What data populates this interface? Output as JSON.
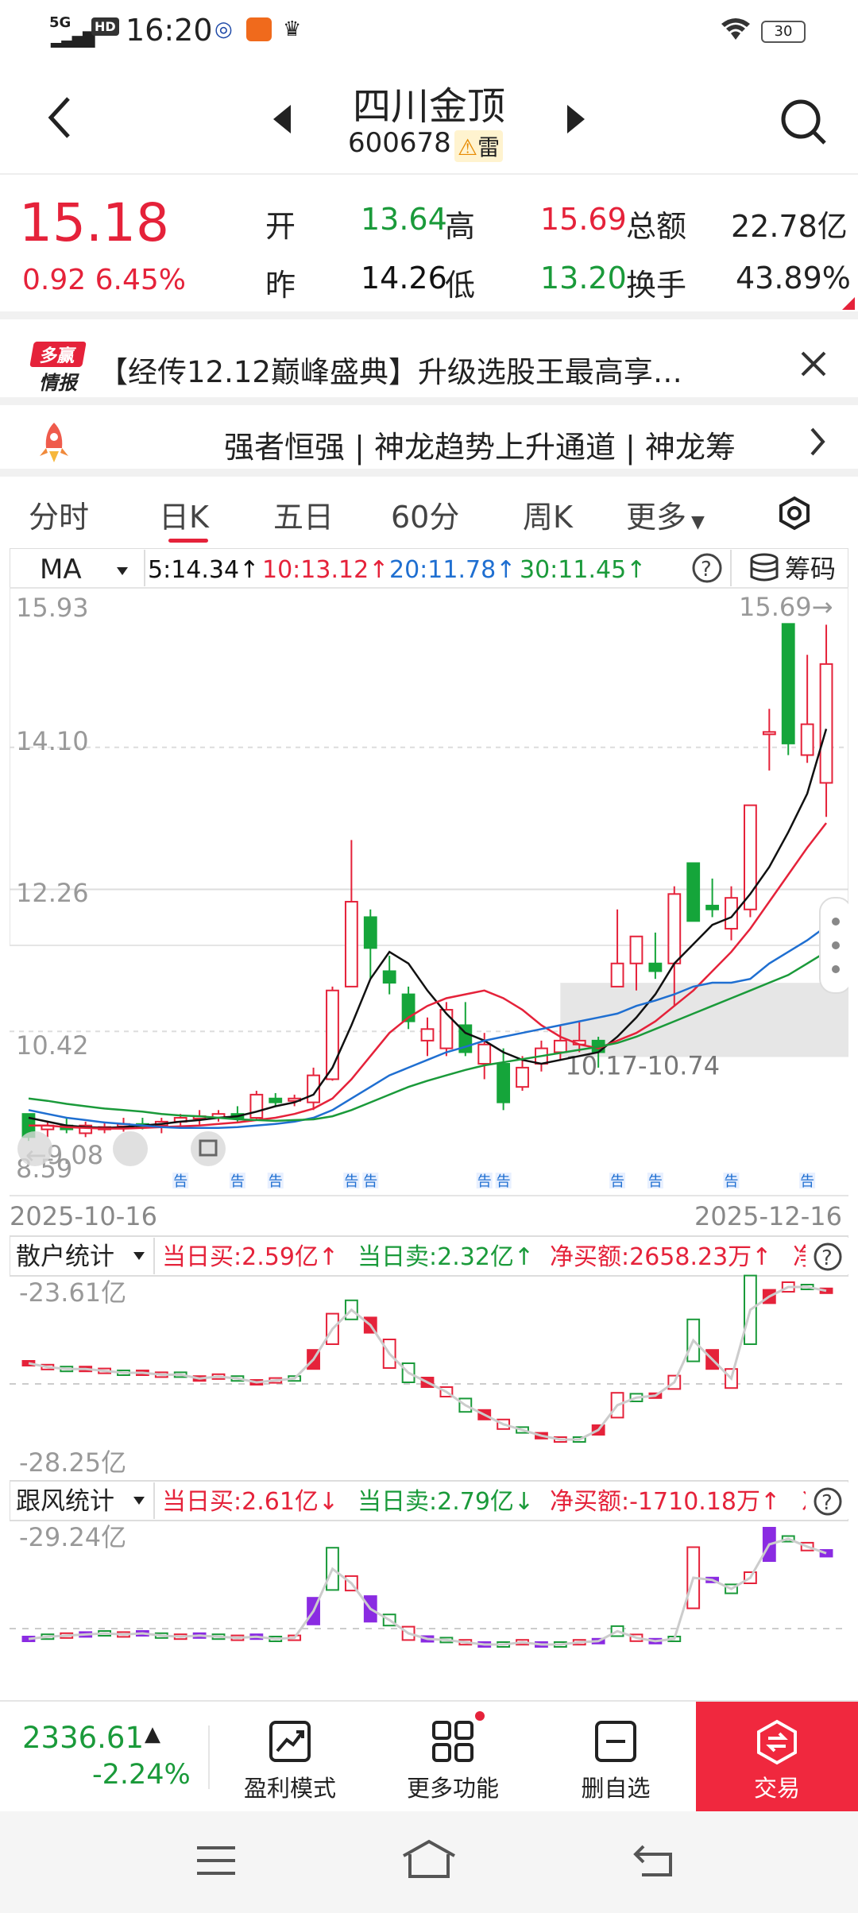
{
  "status": {
    "network": "5G",
    "hd": "HD",
    "time": "16:20",
    "battery": "30"
  },
  "nav": {
    "stock_name": "四川金顶",
    "stock_code": "600678",
    "risk_tag": "雷"
  },
  "quote": {
    "price": "15.18",
    "change": "0.92",
    "change_pct": "6.45%",
    "open_label": "开",
    "open": "13.64",
    "high_label": "高",
    "high": "15.69",
    "amount_label": "总额",
    "amount": "22.78亿",
    "prev_label": "昨",
    "prev": "14.26",
    "low_label": "低",
    "low": "13.20",
    "turnover_label": "换手",
    "turnover": "43.89%"
  },
  "ad": {
    "logo_line1": "多赢",
    "logo_line2": "情报",
    "text": "【经传12.12巅峰盛典】升级选股王最高享…"
  },
  "banner": {
    "text": "强者恒强 | 神龙趋势上升通道 | 神龙筹"
  },
  "tabs": [
    "分时",
    "日K",
    "五日",
    "60分",
    "周K",
    "更多"
  ],
  "active_tab": "日K",
  "ma_bar": {
    "indicator": "MA",
    "ma5": "5:14.34↑",
    "ma10": "10:13.12↑",
    "ma20": "20:11.78↑",
    "ma30": "30:11.45↑",
    "chips_label": "筹码"
  },
  "main_chart": {
    "y_labels": [
      "15.93",
      "14.10",
      "12.26",
      "10.42",
      "8.59"
    ],
    "high_marker": "15.69→",
    "low_marker": "←9.08",
    "support_zone": "10.17-10.74",
    "date_start": "2025-10-16",
    "date_end": "2025-12-16",
    "notice_label": "告"
  },
  "chart_data": {
    "type": "candlestick",
    "x_range": [
      "2025-10-16",
      "2025-12-16"
    ],
    "y_range": [
      8.59,
      15.93
    ],
    "candles": [
      {
        "o": 9.35,
        "h": 9.35,
        "l": 9.0,
        "c": 9.05
      },
      {
        "o": 9.15,
        "h": 9.25,
        "l": 9.05,
        "c": 9.2
      },
      {
        "o": 9.2,
        "h": 9.3,
        "l": 9.1,
        "c": 9.15
      },
      {
        "o": 9.1,
        "h": 9.25,
        "l": 9.05,
        "c": 9.2
      },
      {
        "o": 9.15,
        "h": 9.25,
        "l": 9.1,
        "c": 9.18
      },
      {
        "o": 9.2,
        "h": 9.3,
        "l": 9.12,
        "c": 9.22
      },
      {
        "o": 9.22,
        "h": 9.3,
        "l": 9.15,
        "c": 9.18
      },
      {
        "o": 9.2,
        "h": 9.3,
        "l": 9.1,
        "c": 9.25
      },
      {
        "o": 9.25,
        "h": 9.35,
        "l": 9.2,
        "c": 9.3
      },
      {
        "o": 9.3,
        "h": 9.4,
        "l": 9.2,
        "c": 9.32
      },
      {
        "o": 9.3,
        "h": 9.4,
        "l": 9.25,
        "c": 9.35
      },
      {
        "o": 9.35,
        "h": 9.45,
        "l": 9.25,
        "c": 9.3
      },
      {
        "o": 9.3,
        "h": 9.65,
        "l": 9.28,
        "c": 9.6
      },
      {
        "o": 9.55,
        "h": 9.62,
        "l": 9.45,
        "c": 9.5
      },
      {
        "o": 9.52,
        "h": 9.6,
        "l": 9.45,
        "c": 9.55
      },
      {
        "o": 9.5,
        "h": 9.95,
        "l": 9.4,
        "c": 9.85
      },
      {
        "o": 9.8,
        "h": 11.0,
        "l": 9.78,
        "c": 10.95
      },
      {
        "o": 11.0,
        "h": 12.9,
        "l": 11.9,
        "c": 12.1
      },
      {
        "o": 11.9,
        "h": 12.0,
        "l": 11.1,
        "c": 11.5
      },
      {
        "o": 11.2,
        "h": 11.4,
        "l": 10.9,
        "c": 11.05
      },
      {
        "o": 10.9,
        "h": 11.0,
        "l": 10.45,
        "c": 10.55
      },
      {
        "o": 10.3,
        "h": 10.6,
        "l": 10.1,
        "c": 10.45
      },
      {
        "o": 10.2,
        "h": 10.8,
        "l": 10.1,
        "c": 10.7
      },
      {
        "o": 10.5,
        "h": 10.8,
        "l": 10.1,
        "c": 10.15
      },
      {
        "o": 10.0,
        "h": 10.4,
        "l": 9.8,
        "c": 10.25
      },
      {
        "o": 10.0,
        "h": 10.2,
        "l": 9.4,
        "c": 9.5
      },
      {
        "o": 9.7,
        "h": 10.1,
        "l": 9.65,
        "c": 9.95
      },
      {
        "o": 10.0,
        "h": 10.3,
        "l": 9.9,
        "c": 10.2
      },
      {
        "o": 10.15,
        "h": 10.5,
        "l": 10.05,
        "c": 10.3
      },
      {
        "o": 10.25,
        "h": 10.55,
        "l": 10.15,
        "c": 10.3
      },
      {
        "o": 10.3,
        "h": 10.35,
        "l": 9.95,
        "c": 10.15
      },
      {
        "o": 11.0,
        "h": 12.0,
        "l": 11.2,
        "c": 11.3
      },
      {
        "o": 11.3,
        "h": 11.6,
        "l": 10.95,
        "c": 11.65
      },
      {
        "o": 11.3,
        "h": 11.7,
        "l": 11.1,
        "c": 11.2
      },
      {
        "o": 11.3,
        "h": 12.3,
        "l": 10.75,
        "c": 12.2
      },
      {
        "o": 12.6,
        "h": 12.6,
        "l": 11.85,
        "c": 11.85
      },
      {
        "o": 12.05,
        "h": 12.4,
        "l": 11.9,
        "c": 12.0
      },
      {
        "o": 11.75,
        "h": 12.3,
        "l": 11.6,
        "c": 12.15
      },
      {
        "o": 12.0,
        "h": 13.35,
        "l": 11.9,
        "c": 13.35
      },
      {
        "o": 14.3,
        "h": 14.6,
        "l": 13.8,
        "c": 14.3
      },
      {
        "o": 15.7,
        "h": 15.7,
        "l": 14.0,
        "c": 14.15
      },
      {
        "o": 14.0,
        "h": 15.3,
        "l": 13.9,
        "c": 14.4
      },
      {
        "o": 13.64,
        "h": 15.69,
        "l": 13.2,
        "c": 15.18
      }
    ],
    "ma5": [
      9.3,
      9.25,
      9.2,
      9.18,
      9.17,
      9.18,
      9.2,
      9.22,
      9.25,
      9.27,
      9.3,
      9.32,
      9.38,
      9.45,
      9.5,
      9.6,
      9.95,
      10.5,
      11.1,
      11.45,
      11.3,
      10.95,
      10.65,
      10.4,
      10.3,
      10.15,
      10.05,
      10.0,
      10.05,
      10.1,
      10.15,
      10.35,
      10.6,
      10.9,
      11.3,
      11.55,
      11.8,
      11.9,
      12.2,
      12.55,
      13.0,
      13.5,
      14.34
    ],
    "ma10": [
      9.2,
      9.2,
      9.18,
      9.17,
      9.16,
      9.16,
      9.17,
      9.18,
      9.19,
      9.2,
      9.22,
      9.24,
      9.27,
      9.3,
      9.35,
      9.42,
      9.55,
      9.8,
      10.1,
      10.4,
      10.6,
      10.75,
      10.85,
      10.9,
      10.95,
      10.85,
      10.7,
      10.5,
      10.35,
      10.25,
      10.2,
      10.3,
      10.4,
      10.55,
      10.75,
      10.95,
      11.2,
      11.45,
      11.75,
      12.1,
      12.45,
      12.8,
      13.12
    ],
    "ma20": [
      9.4,
      9.35,
      9.3,
      9.27,
      9.24,
      9.22,
      9.2,
      9.18,
      9.17,
      9.17,
      9.17,
      9.18,
      9.2,
      9.22,
      9.25,
      9.3,
      9.4,
      9.55,
      9.7,
      9.85,
      9.95,
      10.05,
      10.15,
      10.22,
      10.3,
      10.35,
      10.4,
      10.45,
      10.5,
      10.55,
      10.6,
      10.65,
      10.75,
      10.82,
      10.9,
      11.0,
      11.05,
      11.05,
      11.1,
      11.3,
      11.45,
      11.6,
      11.78
    ],
    "ma30": [
      9.55,
      9.52,
      9.48,
      9.45,
      9.42,
      9.4,
      9.38,
      9.35,
      9.33,
      9.32,
      9.3,
      9.28,
      9.27,
      9.26,
      9.27,
      9.28,
      9.32,
      9.4,
      9.5,
      9.6,
      9.7,
      9.78,
      9.85,
      9.92,
      9.98,
      10.02,
      10.06,
      10.1,
      10.14,
      10.18,
      10.22,
      10.27,
      10.35,
      10.45,
      10.55,
      10.65,
      10.75,
      10.85,
      10.95,
      11.05,
      11.15,
      11.3,
      11.45
    ],
    "support_zone": [
      10.17,
      10.74
    ]
  },
  "panel1": {
    "name": "散户统计",
    "buy": "当日买:2.59亿↑",
    "sell": "当日卖:2.32亿↑",
    "net": "净买额:2658.23万↑",
    "net_more": "净",
    "top_label": "-23.61亿",
    "bottom_label": "-28.25亿"
  },
  "panel2": {
    "name": "跟风统计",
    "buy": "当日买:2.61亿↓",
    "sell": "当日卖:2.79亿↓",
    "net": "净买额:-1710.18万↑",
    "net_more": "冫",
    "top_label": "-29.24亿"
  },
  "bottombar": {
    "index_value": "2336.61",
    "index_change": "-2.24%",
    "items": [
      "盈利模式",
      "更多功能",
      "删自选",
      "交易"
    ]
  }
}
